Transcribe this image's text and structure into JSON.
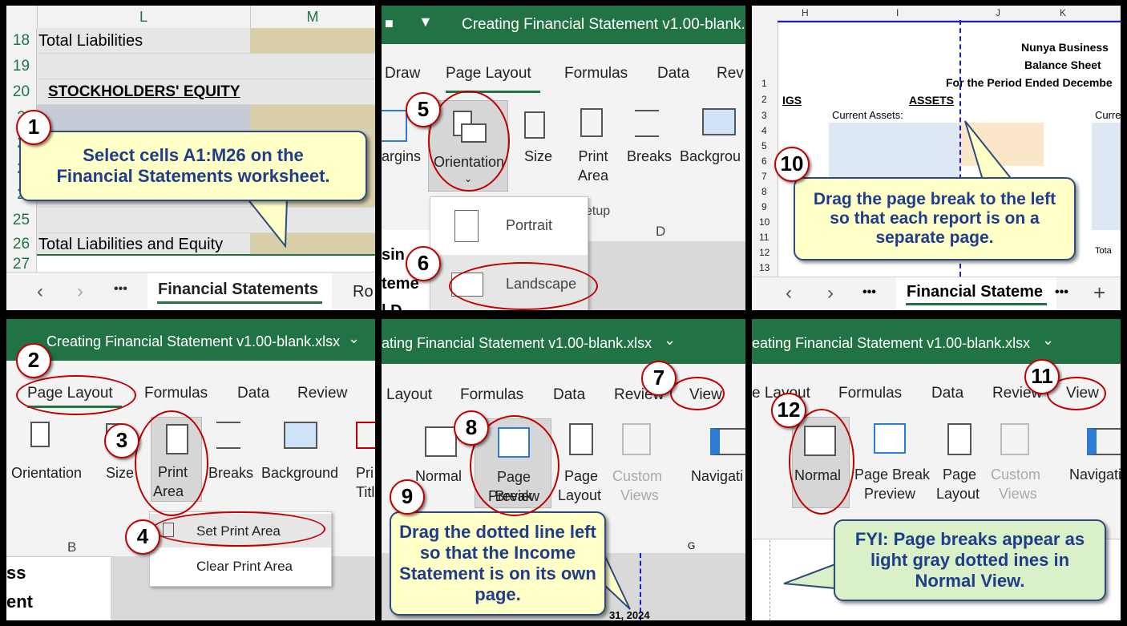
{
  "p1": {
    "col_l": "L",
    "col_m": "M",
    "rows": [
      {
        "n": "18",
        "text": "Total Liabilities"
      },
      {
        "n": "19",
        "text": ""
      },
      {
        "n": "20",
        "text": "STOCKHOLDERS' EQUITY"
      },
      {
        "n": "2",
        "text": ""
      },
      {
        "n": "2",
        "text": ""
      },
      {
        "n": "2",
        "text": ""
      },
      {
        "n": "2",
        "text": ""
      },
      {
        "n": "25",
        "text": ""
      },
      {
        "n": "26",
        "text": "Total Liabilities and Equity"
      },
      {
        "n": "27",
        "text": ""
      }
    ],
    "sheet_tab": "Financial Statements",
    "next_tab": "Ro",
    "more": "•••",
    "callout": "Select cells A1:M26 on the Financial Statements worksheet."
  },
  "p2": {
    "title": "Creating Financial Statement v1.00-blank.x",
    "tabs": [
      "Draw",
      "Page Layout",
      "Formulas",
      "Data",
      "Rev"
    ],
    "margins": "argins",
    "orientation": "Orientation",
    "size": "Size",
    "print_area": "Print Area",
    "breaks": "Breaks",
    "background": "Backgrou",
    "group": "etup",
    "portrait": "Portrait",
    "landscape": "Landscape",
    "col_d": "D",
    "partial_lines": [
      "sin",
      "teme",
      "l D"
    ]
  },
  "p3": {
    "cols": [
      "H",
      "I",
      "J",
      "K"
    ],
    "company": "Nunya Business",
    "sheet": "Balance Sheet",
    "period": "For the Period Ended Decembe",
    "igs": "IGS",
    "assets": "ASSETS",
    "current_assets": "Current Assets:",
    "curr": "Curre",
    "total": "Tota",
    "row_nums": [
      "1",
      "2",
      "3",
      "4",
      "5",
      "6",
      "7",
      "8",
      "9",
      "10",
      "11",
      "12",
      "13"
    ],
    "sheet_tab": "Financial Stateme",
    "more": "•••",
    "plus": "+",
    "callout": "Drag the page break to the left so that each report is on a separate page."
  },
  "p4": {
    "title": "Creating Financial Statement v1.00-blank.xlsx",
    "tabs": [
      "Page Layout",
      "Formulas",
      "Data",
      "Review"
    ],
    "orientation": "Orientation",
    "size": "Size",
    "print": "Print",
    "area": "Area",
    "breaks": "Breaks",
    "background": "Background",
    "pri": "Pri",
    "titl": "Titl",
    "set_print_area": "Set Print Area",
    "clear_print_area": "Clear Print Area",
    "col_b": "B",
    "partial_lines": [
      "ss",
      "ent"
    ]
  },
  "p5": {
    "title": "ating Financial Statement v1.00-blank.xlsx",
    "tabs": [
      "Layout",
      "Formulas",
      "Data",
      "Review",
      "View"
    ],
    "normal": "Normal",
    "page_break": "Page Break",
    "preview": "Preview",
    "page": "Page",
    "layout": "Layout",
    "custom": "Custom",
    "views": "Views",
    "navigation": "Navigati",
    "col_g": "G",
    "date": "31, 2024",
    "callout": "Drag the dotted line left so that the Income Statement is on its own page."
  },
  "p6": {
    "title": "eating Financial Statement v1.00-blank.xlsx",
    "tabs": [
      "e Layout",
      "Formulas",
      "Data",
      "Review",
      "View"
    ],
    "normal": "Normal",
    "page_break": "Page Break",
    "preview": "Preview",
    "page": "Page",
    "layout": "Layout",
    "custom": "Custom",
    "views": "Views",
    "navigation": "Navigati",
    "callout": "FYI: Page breaks appear as light gray dotted ines in Normal View."
  },
  "steps": [
    "1",
    "2",
    "3",
    "4",
    "5",
    "6",
    "7",
    "8",
    "9",
    "10",
    "11",
    "12"
  ]
}
